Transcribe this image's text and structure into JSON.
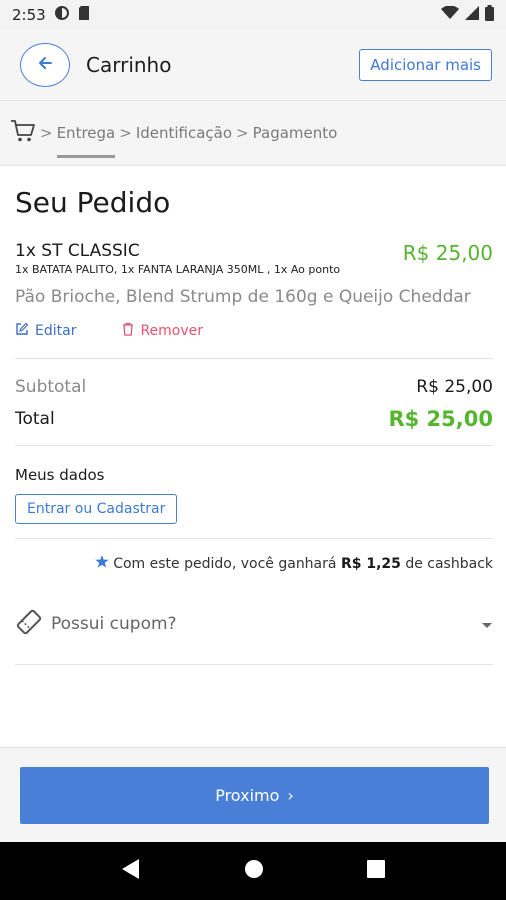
{
  "status_bar": {
    "time": "2:53",
    "icons": [
      "data-saver-icon",
      "sim-card-icon",
      "wifi-icon",
      "signal-icon",
      "battery-icon"
    ]
  },
  "header": {
    "title": "Carrinho",
    "add_more_label": "Adicionar mais",
    "accent_color": "#4a7fd8"
  },
  "steps": {
    "items": [
      "Entrega",
      "Identificação",
      "Pagamento"
    ],
    "separator": ">",
    "active_index": 0
  },
  "order": {
    "title": "Seu Pedido",
    "item": {
      "name": "1x ST CLASSIC",
      "price": "R$ 25,00",
      "extras": "1x BATATA PALITO, 1x FANTA LARANJA 350ML , 1x Ao ponto",
      "description": "Pão Brioche, Blend Strump de 160g e Queijo Cheddar",
      "edit_label": "Editar",
      "remove_label": "Remover"
    },
    "subtotal_label": "Subtotal",
    "subtotal_value": "R$ 25,00",
    "total_label": "Total",
    "total_value": "R$ 25,00",
    "price_color": "#55b52f"
  },
  "my_data": {
    "title": "Meus dados",
    "login_label": "Entrar ou Cadastrar"
  },
  "cashback": {
    "prefix": "Com este pedido, você ganhará",
    "amount": "R$ 1,25",
    "suffix": "de cashback"
  },
  "coupon": {
    "label": "Possui cupom?"
  },
  "footer": {
    "next_label": "Proximo",
    "next_arrow": "›"
  },
  "nav_bar": {
    "icons": [
      "back-triangle-icon",
      "home-circle-icon",
      "recents-square-icon"
    ]
  }
}
